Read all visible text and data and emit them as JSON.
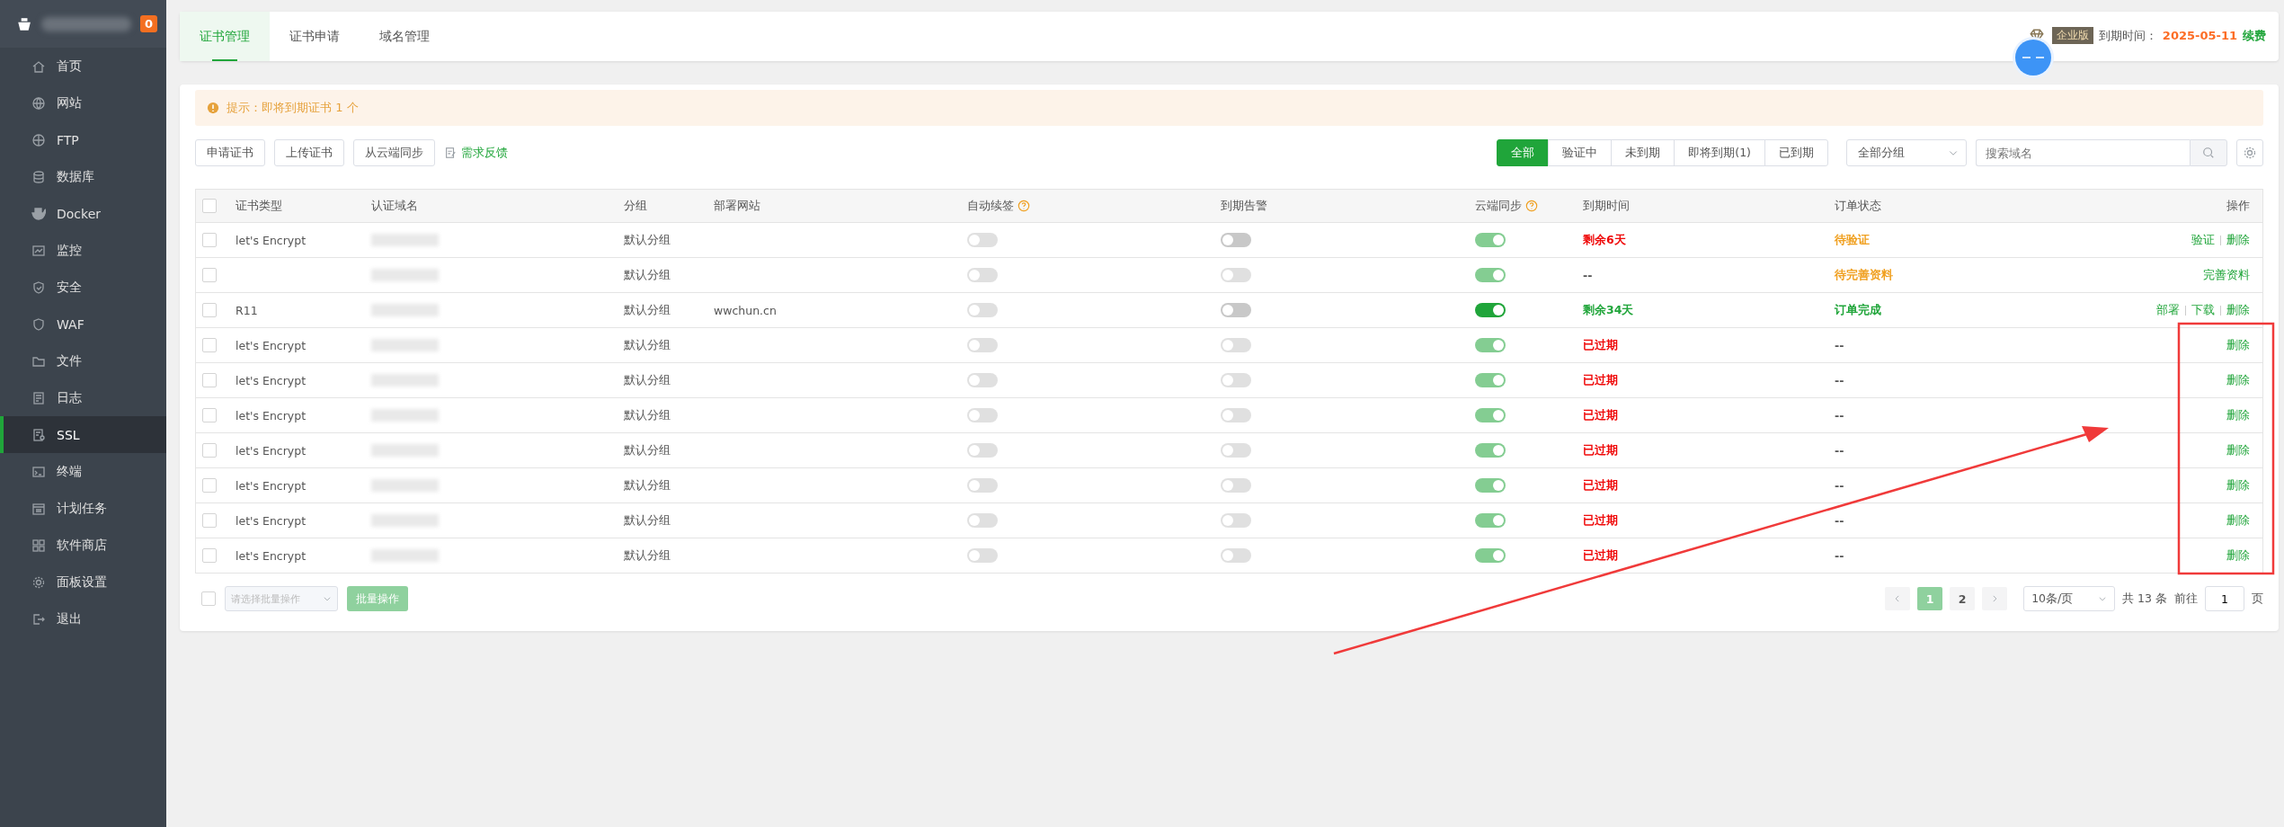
{
  "sidebar": {
    "badge": "0",
    "items": [
      {
        "label": "首页",
        "selected": false
      },
      {
        "label": "网站",
        "selected": false
      },
      {
        "label": "FTP",
        "selected": false
      },
      {
        "label": "数据库",
        "selected": false
      },
      {
        "label": "Docker",
        "selected": false
      },
      {
        "label": "监控",
        "selected": false
      },
      {
        "label": "安全",
        "selected": false
      },
      {
        "label": "WAF",
        "selected": false
      },
      {
        "label": "文件",
        "selected": false
      },
      {
        "label": "日志",
        "selected": false
      },
      {
        "label": "SSL",
        "selected": true
      },
      {
        "label": "终端",
        "selected": false
      },
      {
        "label": "计划任务",
        "selected": false
      },
      {
        "label": "软件商店",
        "selected": false
      },
      {
        "label": "面板设置",
        "selected": false
      },
      {
        "label": "退出",
        "selected": false
      }
    ]
  },
  "tabs": [
    {
      "label": "证书管理",
      "selected": true
    },
    {
      "label": "证书申请",
      "selected": false
    },
    {
      "label": "域名管理",
      "selected": false
    }
  ],
  "license": {
    "edition": "企业版",
    "expiry_label": "到期时间：",
    "expiry_date": "2025-05-11",
    "renew": "续费"
  },
  "notice": {
    "text": "提示：即将到期证书 1 个"
  },
  "actions": [
    "申请证书",
    "上传证书",
    "从云端同步"
  ],
  "feedback": "需求反馈",
  "filters": [
    {
      "label": "全部",
      "selected": true
    },
    {
      "label": "验证中",
      "selected": false
    },
    {
      "label": "未到期",
      "selected": false
    },
    {
      "label": "即将到期(1)",
      "selected": false
    },
    {
      "label": "已到期",
      "selected": false
    }
  ],
  "group_select": {
    "value": "全部分组"
  },
  "search": {
    "placeholder": "搜索域名"
  },
  "table": {
    "columns": [
      {
        "label": "证书类型",
        "checked": false
      },
      {
        "label": "认证域名"
      },
      {
        "label": "分组"
      },
      {
        "label": "部署网站"
      },
      {
        "label": "自动续签",
        "help": true
      },
      {
        "label": "到期告警"
      },
      {
        "label": "云端同步",
        "help": true
      },
      {
        "label": "到期时间"
      },
      {
        "label": "订单状态"
      },
      {
        "label": "操作"
      }
    ],
    "rows": [
      {
        "checked": false,
        "type": "let's Encrypt",
        "domain_redacted": true,
        "group": "默认分组",
        "auto_renew": {
          "on": false,
          "disabled": true
        },
        "alert": {
          "on": false,
          "disabled": false
        },
        "sync": {
          "on": true,
          "disabled": true
        },
        "expiry": {
          "text": "剩余6天",
          "color": "#ef0808"
        },
        "order": {
          "text": "待验证",
          "color": "#f0a020"
        },
        "ops": [
          "验证",
          "删除"
        ]
      },
      {
        "checked": false,
        "domain_redacted": true,
        "group": "默认分组",
        "auto_renew": {
          "on": false,
          "disabled": true
        },
        "alert": {
          "on": false,
          "disabled": true
        },
        "sync": {
          "on": true,
          "disabled": true
        },
        "expiry": {
          "text": "--",
          "color": "#555555"
        },
        "order": {
          "text": "待完善资料",
          "color": "#f0a020"
        },
        "ops": [
          "完善资料"
        ]
      },
      {
        "checked": false,
        "type": "R11",
        "domain_redacted": true,
        "group": "默认分组",
        "site": "wwchun.cn",
        "auto_renew": {
          "on": false,
          "disabled": true
        },
        "alert": {
          "on": false,
          "disabled": false
        },
        "sync": {
          "on": true,
          "disabled": false
        },
        "expiry": {
          "text": "剩余34天",
          "color": "#20a53a"
        },
        "order": {
          "text": "订单完成",
          "color": "#20a53a"
        },
        "ops": [
          "部署",
          "下载",
          "删除"
        ]
      },
      {
        "checked": false,
        "type": "let's Encrypt",
        "domain_redacted": true,
        "group": "默认分组",
        "auto_renew": {
          "on": false,
          "disabled": true
        },
        "alert": {
          "on": false,
          "disabled": true
        },
        "sync": {
          "on": true,
          "disabled": true
        },
        "expiry": {
          "text": "已过期",
          "color": "#ef0808"
        },
        "order": {
          "text": "--",
          "color": "#555555"
        },
        "ops": [
          "删除"
        ]
      },
      {
        "checked": false,
        "type": "let's Encrypt",
        "domain_redacted": true,
        "group": "默认分组",
        "auto_renew": {
          "on": false,
          "disabled": true
        },
        "alert": {
          "on": false,
          "disabled": true
        },
        "sync": {
          "on": true,
          "disabled": true
        },
        "expiry": {
          "text": "已过期",
          "color": "#ef0808"
        },
        "order": {
          "text": "--",
          "color": "#555555"
        },
        "ops": [
          "删除"
        ]
      },
      {
        "checked": false,
        "type": "let's Encrypt",
        "domain_redacted": true,
        "group": "默认分组",
        "auto_renew": {
          "on": false,
          "disabled": true
        },
        "alert": {
          "on": false,
          "disabled": true
        },
        "sync": {
          "on": true,
          "disabled": true
        },
        "expiry": {
          "text": "已过期",
          "color": "#ef0808"
        },
        "order": {
          "text": "--",
          "color": "#555555"
        },
        "ops": [
          "删除"
        ]
      },
      {
        "checked": false,
        "type": "let's Encrypt",
        "domain_redacted": true,
        "group": "默认分组",
        "auto_renew": {
          "on": false,
          "disabled": true
        },
        "alert": {
          "on": false,
          "disabled": true
        },
        "sync": {
          "on": true,
          "disabled": true
        },
        "expiry": {
          "text": "已过期",
          "color": "#ef0808"
        },
        "order": {
          "text": "--",
          "color": "#555555"
        },
        "ops": [
          "删除"
        ]
      },
      {
        "checked": false,
        "type": "let's Encrypt",
        "domain_redacted": true,
        "group": "默认分组",
        "auto_renew": {
          "on": false,
          "disabled": true
        },
        "alert": {
          "on": false,
          "disabled": true
        },
        "sync": {
          "on": true,
          "disabled": true
        },
        "expiry": {
          "text": "已过期",
          "color": "#ef0808"
        },
        "order": {
          "text": "--",
          "color": "#555555"
        },
        "ops": [
          "删除"
        ]
      },
      {
        "checked": false,
        "type": "let's Encrypt",
        "domain_redacted": true,
        "group": "默认分组",
        "auto_renew": {
          "on": false,
          "disabled": true
        },
        "alert": {
          "on": false,
          "disabled": true
        },
        "sync": {
          "on": true,
          "disabled": true
        },
        "expiry": {
          "text": "已过期",
          "color": "#ef0808"
        },
        "order": {
          "text": "--",
          "color": "#555555"
        },
        "ops": [
          "删除"
        ]
      },
      {
        "checked": false,
        "type": "let's Encrypt",
        "domain_redacted": true,
        "group": "默认分组",
        "auto_renew": {
          "on": false,
          "disabled": true
        },
        "alert": {
          "on": false,
          "disabled": true
        },
        "sync": {
          "on": true,
          "disabled": true
        },
        "expiry": {
          "text": "已过期",
          "color": "#ef0808"
        },
        "order": {
          "text": "--",
          "color": "#555555"
        },
        "ops": [
          "删除"
        ]
      }
    ]
  },
  "footer": {
    "checked": false,
    "batch_select": {
      "placeholder": "请选择批量操作"
    },
    "batch_button": "批量操作",
    "pages": [
      {
        "label": "1",
        "selected": true
      },
      {
        "label": "2",
        "selected": false
      }
    ],
    "page_size": "10条/页",
    "total": "共 13 条",
    "goto_label": "前往",
    "goto_value": "1",
    "page_unit": "页"
  }
}
